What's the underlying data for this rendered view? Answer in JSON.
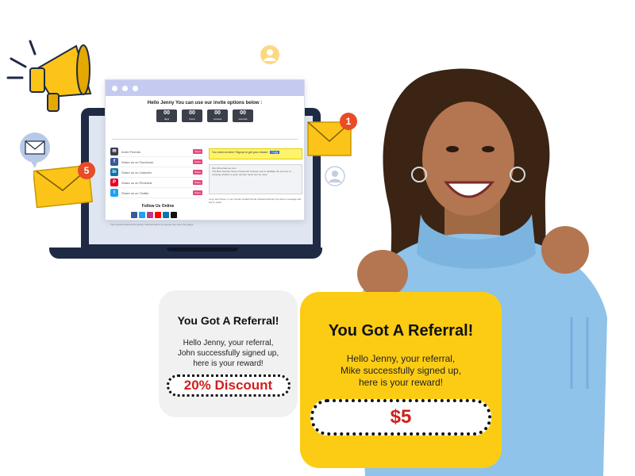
{
  "browser": {
    "invite_title": "Hello Jenny You can use our invite options below :",
    "timer": [
      {
        "value": "00",
        "label": "days"
      },
      {
        "value": "00",
        "label": "hours"
      },
      {
        "value": "00",
        "label": "minutes"
      },
      {
        "value": "00",
        "label": "seconds"
      }
    ],
    "share_items": [
      {
        "label": "Invite Friends",
        "button": "Send",
        "color": "#3a3f4a",
        "icon": "invite-icon"
      },
      {
        "label": "Share us on Facebook",
        "button": "Share",
        "color": "#3b5998",
        "icon": "facebook-icon"
      },
      {
        "label": "Share us on LinkedIn",
        "button": "Share",
        "color": "#0e76a8",
        "icon": "linkedin-icon"
      },
      {
        "label": "Share us on Pinterest",
        "button": "Share",
        "color": "#e60023",
        "icon": "pinterest-icon"
      },
      {
        "label": "Share us on Twitter",
        "button": "Share",
        "color": "#1da1f2",
        "icon": "twitter-icon"
      }
    ],
    "follow_title": "Follow Us Online",
    "message_highlight": "You need an idea? Signup to get your reward",
    "message_copy": "Copy",
    "message_url": "http://driverdemon.com",
    "message_text": "The Best Domain Name Trademark Checker tool to facilitate the process of verifying whether a given domain name can be used.",
    "message_footer": "Copy and Paste in your Social media/Friends Followers/Family the above message and link to share",
    "foot_note": "Your social media will be shown referral buttons so people can open the pages."
  },
  "badges": {
    "left_count": "5",
    "right_count": "1"
  },
  "card_grey": {
    "title": "You Got A Referral!",
    "line1": "Hello Jenny, your  referral,",
    "line2": "John successfully  signed up,",
    "line3": "here is your reward!",
    "reward": "20% Discount"
  },
  "card_yellow": {
    "title": "You Got A Referral!",
    "line1": "Hello Jenny, your  referral,",
    "line2": "Mike successfully  signed up,",
    "line3": "here is your reward!",
    "reward": "$5"
  },
  "colors": {
    "yellow_card": "#fccc14",
    "grey_card": "#f1f1f1",
    "reward_red": "#d0201c",
    "badge_orange": "#e84b26",
    "laptop_navy": "#1f2a44"
  }
}
